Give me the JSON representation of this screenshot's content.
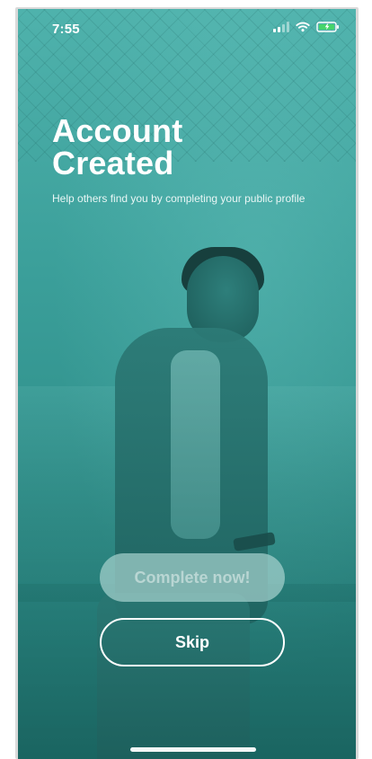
{
  "status_bar": {
    "time": "7:55",
    "icons": [
      "signal-icon",
      "wifi-icon",
      "battery-charging-icon"
    ]
  },
  "onboarding": {
    "title_lines": [
      "Account",
      "Created"
    ],
    "subtitle": "Help others find you by completing your public profile",
    "complete_button_label": "Complete now!",
    "skip_button_label": "Skip"
  },
  "colors": {
    "overlay_teal": "#3a9c98",
    "text": "#ffffff",
    "complete_button_bg": "#a0cdca"
  }
}
